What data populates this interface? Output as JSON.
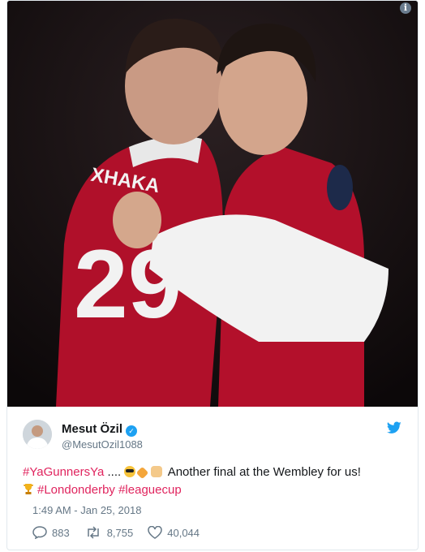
{
  "photo": {
    "alt": "Two Arsenal players embracing",
    "jersey_name": "XHAKA",
    "jersey_number": "29"
  },
  "tweet": {
    "author_name": "Mesut Özil",
    "author_handle": "@MesutOzil1088",
    "text": {
      "tag1": "#YaGunnersYa",
      "dots": " .... ",
      "rest": " Another final at the Wembley for us!",
      "tag2": "#Londonderby",
      "tag3": "#leaguecup"
    },
    "emojis": [
      "sunglasses-emoji",
      "collision-emoji",
      "fist-emoji",
      "trophy-emoji"
    ],
    "timestamp": "1:49 AM - Jan 25, 2018",
    "replies": "883",
    "retweets": "8,755",
    "likes": "40,044"
  },
  "colors": {
    "hashtag": "#e0245e",
    "verified": "#1da1f2",
    "muted": "#657786",
    "arsenal_red": "#c8102e"
  }
}
